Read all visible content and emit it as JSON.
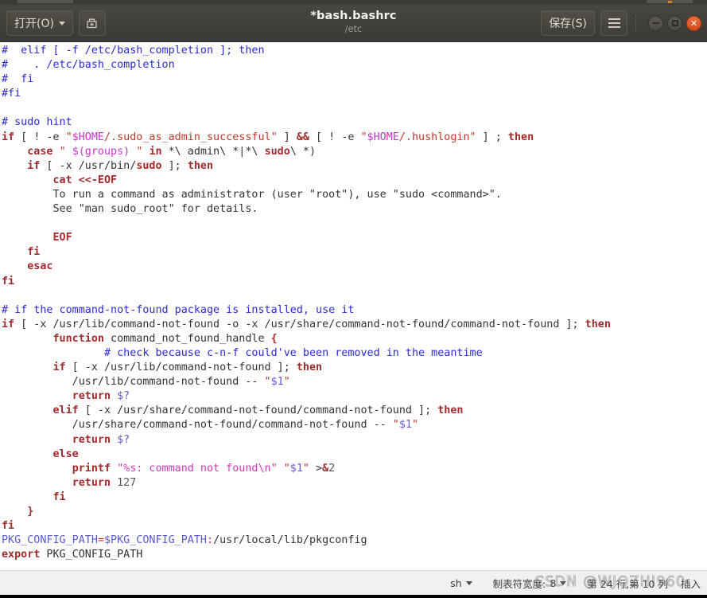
{
  "window": {
    "title": "*bash.bashrc",
    "subtitle": "/etc",
    "open_button": "打开(O)",
    "save_button": "保存(S)",
    "saveas_icon": "save-as-icon",
    "menu_icon": "hamburger-menu-icon",
    "minimize_icon": "minimize-icon",
    "maximize_icon": "maximize-icon",
    "close_icon": "close-icon"
  },
  "statusbar": {
    "language": "sh",
    "tab_width_label": "制表符宽度:",
    "tab_width_value": "8",
    "cursor_position": "第 24 行,第 10 列",
    "insert_mode": "插入",
    "watermark": "CSDN @WJQZHI960"
  },
  "editor": {
    "lines": [
      [
        {
          "t": "#  elif [ -f /etc/bash_completion ]; then",
          "c": "cmt"
        }
      ],
      [
        {
          "t": "#    . /etc/bash_completion",
          "c": "cmt"
        }
      ],
      [
        {
          "t": "#  fi",
          "c": "cmt"
        }
      ],
      [
        {
          "t": "#fi",
          "c": "cmt"
        }
      ],
      [
        {
          "t": "",
          "c": "pl"
        }
      ],
      [
        {
          "t": "# sudo hint",
          "c": "cmt"
        }
      ],
      [
        {
          "t": "if",
          "c": "kw"
        },
        {
          "t": " [ ",
          "c": "pl"
        },
        {
          "t": "!",
          "c": "pl"
        },
        {
          "t": " -e ",
          "c": "pl"
        },
        {
          "t": "\"",
          "c": "str"
        },
        {
          "t": "$HOME",
          "c": "var"
        },
        {
          "t": "/.sudo_as_admin_successful\"",
          "c": "str"
        },
        {
          "t": " ] ",
          "c": "pl"
        },
        {
          "t": "&&",
          "c": "kw"
        },
        {
          "t": " [ ",
          "c": "pl"
        },
        {
          "t": "!",
          "c": "pl"
        },
        {
          "t": " -e ",
          "c": "pl"
        },
        {
          "t": "\"",
          "c": "str"
        },
        {
          "t": "$HOME",
          "c": "var"
        },
        {
          "t": "/.hushlogin\"",
          "c": "str"
        },
        {
          "t": " ] ; ",
          "c": "pl"
        },
        {
          "t": "then",
          "c": "kw"
        }
      ],
      [
        {
          "t": "    ",
          "c": "pl"
        },
        {
          "t": "case",
          "c": "kw"
        },
        {
          "t": " ",
          "c": "pl"
        },
        {
          "t": "\" ",
          "c": "str"
        },
        {
          "t": "$(groups)",
          "c": "var"
        },
        {
          "t": " \"",
          "c": "str"
        },
        {
          "t": " ",
          "c": "pl"
        },
        {
          "t": "in",
          "c": "kw"
        },
        {
          "t": " *\\ admin\\ *|*\\ ",
          "c": "pl"
        },
        {
          "t": "sudo",
          "c": "kw"
        },
        {
          "t": "\\ *)",
          "c": "pl"
        }
      ],
      [
        {
          "t": "    ",
          "c": "pl"
        },
        {
          "t": "if",
          "c": "kw"
        },
        {
          "t": " [ -x /usr/bin/",
          "c": "pl"
        },
        {
          "t": "sudo",
          "c": "kw"
        },
        {
          "t": " ]; ",
          "c": "pl"
        },
        {
          "t": "then",
          "c": "kw"
        }
      ],
      [
        {
          "t": "        ",
          "c": "pl"
        },
        {
          "t": "cat <<-EOF",
          "c": "kw"
        }
      ],
      [
        {
          "t": "        To run a command as administrator (user \"root\"), use \"sudo <command>\".",
          "c": "pl"
        }
      ],
      [
        {
          "t": "        See \"man sudo_root\" for details.",
          "c": "pl"
        }
      ],
      [
        {
          "t": "",
          "c": "pl"
        }
      ],
      [
        {
          "t": "        ",
          "c": "pl"
        },
        {
          "t": "EOF",
          "c": "kw"
        }
      ],
      [
        {
          "t": "    ",
          "c": "pl"
        },
        {
          "t": "fi",
          "c": "kw"
        }
      ],
      [
        {
          "t": "    ",
          "c": "pl"
        },
        {
          "t": "esac",
          "c": "kw"
        }
      ],
      [
        {
          "t": "fi",
          "c": "kw"
        }
      ],
      [
        {
          "t": "",
          "c": "pl"
        }
      ],
      [
        {
          "t": "# if the command-not-found package is installed, use it",
          "c": "cmt"
        }
      ],
      [
        {
          "t": "if",
          "c": "kw"
        },
        {
          "t": " [ -x /usr/lib/command-not-found -o -x /usr/share/command-not-found/command-not-found ]; ",
          "c": "pl"
        },
        {
          "t": "then",
          "c": "kw"
        }
      ],
      [
        {
          "t": "        ",
          "c": "pl"
        },
        {
          "t": "function",
          "c": "kw"
        },
        {
          "t": " command_not_found_handle ",
          "c": "pl"
        },
        {
          "t": "{",
          "c": "kw"
        }
      ],
      [
        {
          "t": "                # check because c-n-f could've been removed in the meantime",
          "c": "cmt"
        }
      ],
      [
        {
          "t": "        ",
          "c": "pl"
        },
        {
          "t": "if",
          "c": "kw"
        },
        {
          "t": " [ -x /usr/lib/command-not-found ]; ",
          "c": "pl"
        },
        {
          "t": "then",
          "c": "kw"
        }
      ],
      [
        {
          "t": "           /usr/lib/command-not-found -- ",
          "c": "pl"
        },
        {
          "t": "\"",
          "c": "str"
        },
        {
          "t": "$1",
          "c": "var2"
        },
        {
          "t": "\"",
          "c": "str"
        }
      ],
      [
        {
          "t": "           ",
          "c": "pl"
        },
        {
          "t": "return",
          "c": "kw"
        },
        {
          "t": " ",
          "c": "pl"
        },
        {
          "t": "$?",
          "c": "var2"
        }
      ],
      [
        {
          "t": "        ",
          "c": "pl"
        },
        {
          "t": "elif",
          "c": "kw"
        },
        {
          "t": " [ -x /usr/share/command-not-found/command-not-found ]; ",
          "c": "pl"
        },
        {
          "t": "then",
          "c": "kw"
        }
      ],
      [
        {
          "t": "           /usr/share/command-not-found/command-not-found -- ",
          "c": "pl"
        },
        {
          "t": "\"",
          "c": "str"
        },
        {
          "t": "$1",
          "c": "var2"
        },
        {
          "t": "\"",
          "c": "str"
        }
      ],
      [
        {
          "t": "           ",
          "c": "pl"
        },
        {
          "t": "return",
          "c": "kw"
        },
        {
          "t": " ",
          "c": "pl"
        },
        {
          "t": "$?",
          "c": "var2"
        }
      ],
      [
        {
          "t": "        ",
          "c": "pl"
        },
        {
          "t": "else",
          "c": "kw"
        }
      ],
      [
        {
          "t": "           ",
          "c": "pl"
        },
        {
          "t": "printf",
          "c": "kw"
        },
        {
          "t": " ",
          "c": "pl"
        },
        {
          "t": "\"%s: command not found\\n\"",
          "c": "pstr"
        },
        {
          "t": " ",
          "c": "pl"
        },
        {
          "t": "\"",
          "c": "str"
        },
        {
          "t": "$1",
          "c": "var2"
        },
        {
          "t": "\"",
          "c": "str"
        },
        {
          "t": " >",
          "c": "pl"
        },
        {
          "t": "&",
          "c": "kw"
        },
        {
          "t": "2",
          "c": "num"
        }
      ],
      [
        {
          "t": "           ",
          "c": "pl"
        },
        {
          "t": "return",
          "c": "kw"
        },
        {
          "t": " ",
          "c": "pl"
        },
        {
          "t": "127",
          "c": "num"
        }
      ],
      [
        {
          "t": "        ",
          "c": "pl"
        },
        {
          "t": "fi",
          "c": "kw"
        }
      ],
      [
        {
          "t": "    ",
          "c": "pl"
        },
        {
          "t": "}",
          "c": "kw"
        }
      ],
      [
        {
          "t": "fi",
          "c": "kw"
        }
      ],
      [
        {
          "t": "PKG_CONFIG_PATH",
          "c": "pkg"
        },
        {
          "t": "=",
          "c": "str"
        },
        {
          "t": "$PKG_CONFIG_PATH",
          "c": "pkg"
        },
        {
          "t": ":",
          "c": "str"
        },
        {
          "t": "/usr/local/lib/pkgconfig",
          "c": "pl"
        }
      ],
      [
        {
          "t": "export",
          "c": "kw"
        },
        {
          "t": " PKG_CONFIG_PATH",
          "c": "pl"
        }
      ]
    ]
  }
}
